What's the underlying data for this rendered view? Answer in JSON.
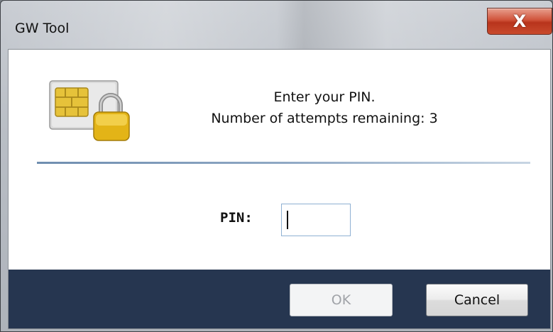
{
  "window": {
    "title": "GW Tool",
    "close_glyph": "X"
  },
  "message": {
    "line1": "Enter your PIN.",
    "line2": "Number of attempts remaining: 3"
  },
  "icon": {
    "name": "sim-card-lock-icon"
  },
  "pin": {
    "label": "PIN:",
    "value": ""
  },
  "buttons": {
    "ok_label": "OK",
    "ok_enabled": false,
    "cancel_label": "Cancel"
  },
  "colors": {
    "footer": "#263650",
    "separator": "#7d9abb",
    "close_button": "#c84a2c"
  }
}
